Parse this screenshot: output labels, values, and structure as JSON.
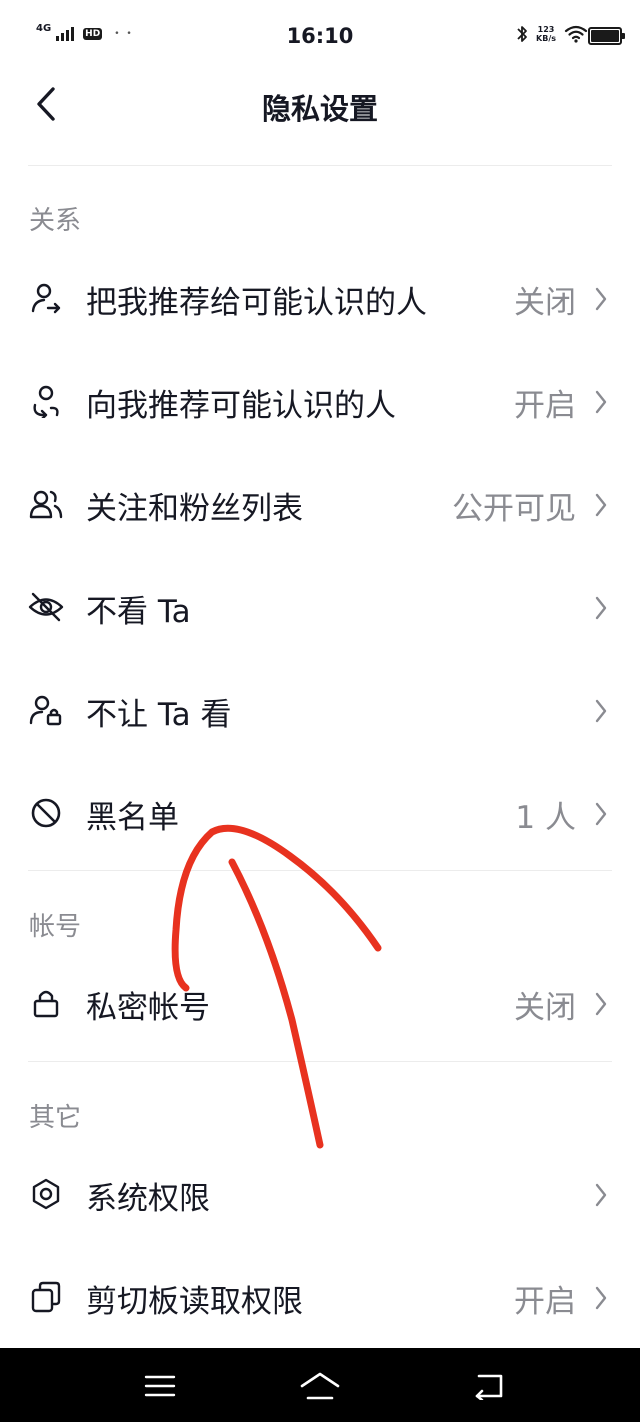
{
  "status_bar": {
    "network": "4G",
    "hd": "HD",
    "dots": "• •",
    "time": "16:10",
    "net_speed_value": "123",
    "net_speed_unit": "KB/s"
  },
  "header": {
    "title": "隐私设置"
  },
  "sections": {
    "relationship": {
      "title": "关系",
      "items": [
        {
          "label": "把我推荐给可能认识的人",
          "value": "关闭",
          "icon": "person-share-icon"
        },
        {
          "label": "向我推荐可能认识的人",
          "value": "开启",
          "icon": "person-recommend-icon"
        },
        {
          "label": "关注和粉丝列表",
          "value": "公开可见",
          "icon": "people-icon"
        },
        {
          "label": "不看 Ta",
          "value": "",
          "icon": "eye-off-icon"
        },
        {
          "label": "不让 Ta 看",
          "value": "",
          "icon": "person-lock-icon"
        },
        {
          "label": "黑名单",
          "value": "1 人",
          "icon": "block-icon"
        }
      ]
    },
    "account": {
      "title": "帐号",
      "items": [
        {
          "label": "私密帐号",
          "value": "关闭",
          "icon": "lock-icon"
        }
      ]
    },
    "other": {
      "title": "其它",
      "items": [
        {
          "label": "系统权限",
          "value": "",
          "icon": "hexagon-settings-icon"
        },
        {
          "label": "剪切板读取权限",
          "value": "开启",
          "icon": "clipboard-icon"
        }
      ]
    }
  },
  "colors": {
    "text_primary": "#161823",
    "text_secondary": "#8a8b91",
    "divider": "#ececec",
    "annotation": "#e8321f",
    "nav_bar": "#000000"
  }
}
